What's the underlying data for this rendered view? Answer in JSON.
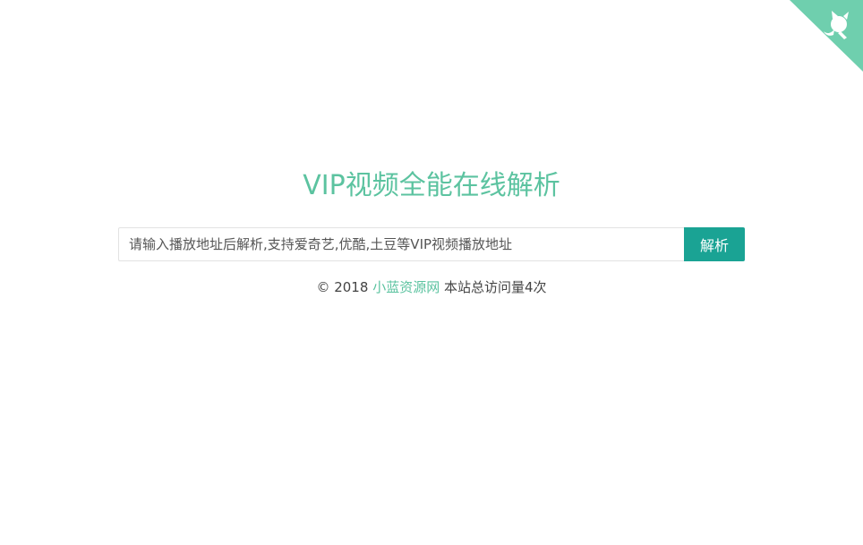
{
  "page": {
    "title": "VIP视频全能在线解析"
  },
  "search": {
    "placeholder": "请输入播放地址后解析,支持爱奇艺,优酷,土豆等VIP视频播放地址",
    "button_label": "解析"
  },
  "footer": {
    "copyright": "© 2018",
    "site_link": "小蓝资源网",
    "visits_text": "本站总访问量4次"
  },
  "corner": {
    "icon": "github-cat-icon",
    "color": "#6fcfae"
  },
  "colors": {
    "accent": "#5cc3a0",
    "button": "#1aa394"
  }
}
